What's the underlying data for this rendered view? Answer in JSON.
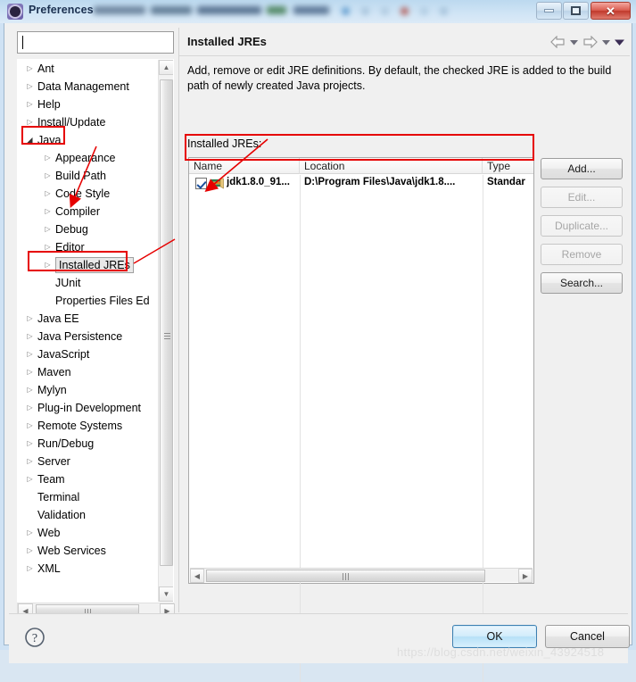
{
  "window": {
    "title": "Preferences",
    "icon": "preferences-gear-icon",
    "controls": {
      "minimize": "–",
      "maximize": "□",
      "close": "✕"
    }
  },
  "sidebar": {
    "filter": {
      "value": "",
      "placeholder": ""
    },
    "items": [
      {
        "label": "Ant",
        "indent": 0,
        "arrow": "collapsed",
        "selected": false
      },
      {
        "label": "Data Management",
        "indent": 0,
        "arrow": "collapsed",
        "selected": false
      },
      {
        "label": "Help",
        "indent": 0,
        "arrow": "collapsed",
        "selected": false
      },
      {
        "label": "Install/Update",
        "indent": 0,
        "arrow": "collapsed",
        "selected": false
      },
      {
        "label": "Java",
        "indent": 0,
        "arrow": "expanded",
        "selected": false
      },
      {
        "label": "Appearance",
        "indent": 1,
        "arrow": "collapsed",
        "selected": false
      },
      {
        "label": "Build Path",
        "indent": 1,
        "arrow": "collapsed",
        "selected": false
      },
      {
        "label": "Code Style",
        "indent": 1,
        "arrow": "collapsed",
        "selected": false
      },
      {
        "label": "Compiler",
        "indent": 1,
        "arrow": "collapsed",
        "selected": false
      },
      {
        "label": "Debug",
        "indent": 1,
        "arrow": "collapsed",
        "selected": false
      },
      {
        "label": "Editor",
        "indent": 1,
        "arrow": "collapsed",
        "selected": false
      },
      {
        "label": "Installed JREs",
        "indent": 1,
        "arrow": "collapsed",
        "selected": true
      },
      {
        "label": "JUnit",
        "indent": 1,
        "arrow": "none",
        "selected": false
      },
      {
        "label": "Properties Files Ed",
        "indent": 1,
        "arrow": "none",
        "selected": false
      },
      {
        "label": "Java EE",
        "indent": 0,
        "arrow": "collapsed",
        "selected": false
      },
      {
        "label": "Java Persistence",
        "indent": 0,
        "arrow": "collapsed",
        "selected": false
      },
      {
        "label": "JavaScript",
        "indent": 0,
        "arrow": "collapsed",
        "selected": false
      },
      {
        "label": "Maven",
        "indent": 0,
        "arrow": "collapsed",
        "selected": false
      },
      {
        "label": "Mylyn",
        "indent": 0,
        "arrow": "collapsed",
        "selected": false
      },
      {
        "label": "Plug-in Development",
        "indent": 0,
        "arrow": "collapsed",
        "selected": false
      },
      {
        "label": "Remote Systems",
        "indent": 0,
        "arrow": "collapsed",
        "selected": false
      },
      {
        "label": "Run/Debug",
        "indent": 0,
        "arrow": "collapsed",
        "selected": false
      },
      {
        "label": "Server",
        "indent": 0,
        "arrow": "collapsed",
        "selected": false
      },
      {
        "label": "Team",
        "indent": 0,
        "arrow": "collapsed",
        "selected": false
      },
      {
        "label": "Terminal",
        "indent": 0,
        "arrow": "none",
        "selected": false
      },
      {
        "label": "Validation",
        "indent": 0,
        "arrow": "none",
        "selected": false
      },
      {
        "label": "Web",
        "indent": 0,
        "arrow": "collapsed",
        "selected": false
      },
      {
        "label": "Web Services",
        "indent": 0,
        "arrow": "collapsed",
        "selected": false
      },
      {
        "label": "XML",
        "indent": 0,
        "arrow": "collapsed",
        "selected": false
      }
    ]
  },
  "page": {
    "title": "Installed JREs",
    "description": "Add, remove or edit JRE definitions. By default, the checked JRE is added to the build path of newly created Java projects.",
    "list_label": "Installed JREs:",
    "nav": {
      "back_icon": "back-arrow-icon",
      "back_menu_icon": "chevron-down-icon",
      "forward_icon": "forward-arrow-icon",
      "forward_menu_icon": "chevron-down-icon",
      "view_menu_icon": "view-menu-chevron-icon"
    }
  },
  "table": {
    "columns": [
      "Name",
      "Location",
      "Type"
    ],
    "rows": [
      {
        "checked": true,
        "icon": "jre-icon",
        "name": "jdk1.8.0_91...",
        "location": "D:\\Program Files\\Java\\jdk1.8....",
        "type": "Standar"
      }
    ]
  },
  "side_buttons": [
    {
      "label": "Add...",
      "enabled": true
    },
    {
      "label": "Edit...",
      "enabled": false
    },
    {
      "label": "Duplicate...",
      "enabled": false
    },
    {
      "label": "Remove",
      "enabled": false
    },
    {
      "label": "Search...",
      "enabled": true
    }
  ],
  "footer": {
    "help_icon": "help-question-icon",
    "ok_label": "OK",
    "cancel_label": "Cancel"
  },
  "watermark": "https://blog.csdn.net/weixin_43924518",
  "annotations": {
    "colors": {
      "highlight": "#e60000"
    },
    "boxes": [
      "java-tree-item",
      "installed-jres-tree-item",
      "jre-table-row"
    ],
    "arrow_from_java_to_compiler": true,
    "arrow_from_installed_jres_to_table": true
  }
}
